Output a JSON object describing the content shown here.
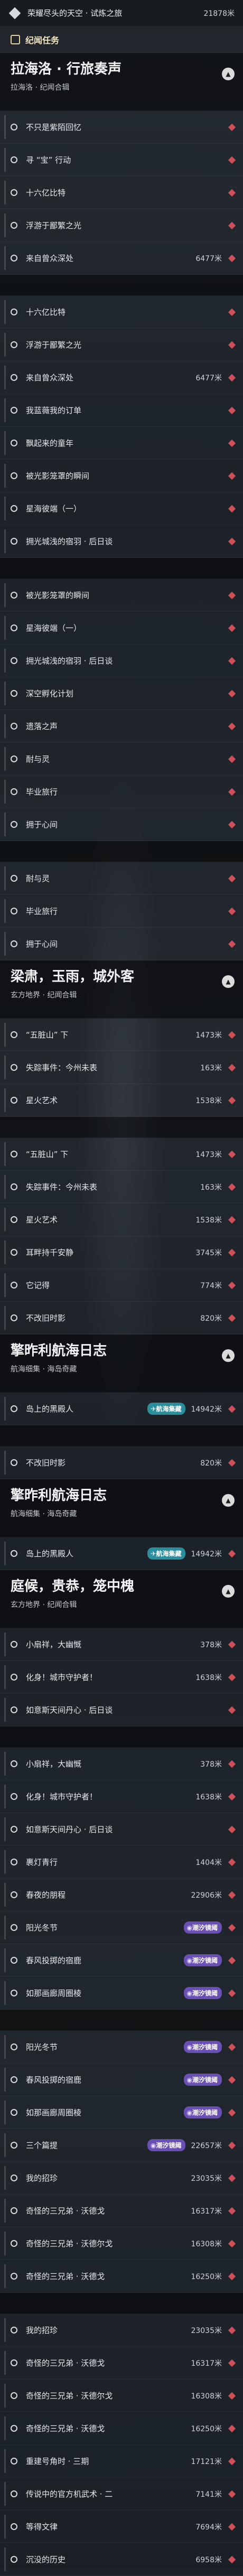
{
  "top": {
    "title": "荣耀尽头的天空 · 试炼之旅",
    "distance": "21878米"
  },
  "tab": {
    "label": "纪闻任务"
  },
  "items": [
    {
      "kind": "head",
      "title": "拉海洛 · 行旅奏声",
      "sub": "拉海洛 · 纪闻合辑"
    },
    {
      "kind": "item",
      "text": "不只是紫陌回忆",
      "dist": "",
      "marker": true
    },
    {
      "kind": "item",
      "text": "寻 “宝” 行动",
      "dist": "",
      "marker": true
    },
    {
      "kind": "item",
      "text": "十六亿比特",
      "dist": "",
      "marker": true
    },
    {
      "kind": "item",
      "text": "浮游于鄙繁之光",
      "dist": "",
      "marker": true
    },
    {
      "kind": "item",
      "text": "来自曾众深处",
      "dist": "6477米",
      "marker": true
    },
    {
      "kind": "gap"
    },
    {
      "kind": "item",
      "text": "十六亿比特",
      "dist": "",
      "marker": true
    },
    {
      "kind": "item",
      "text": "浮游于鄙繁之光",
      "dist": "",
      "marker": true
    },
    {
      "kind": "item",
      "text": "来自曾众深处",
      "dist": "6477米",
      "marker": true
    },
    {
      "kind": "item",
      "text": "我蓝薇我的订单",
      "dist": "",
      "marker": true
    },
    {
      "kind": "item",
      "text": "飘起来的童年",
      "dist": "",
      "marker": true
    },
    {
      "kind": "item",
      "text": "被光影笼罩的瞬间",
      "dist": "",
      "marker": true
    },
    {
      "kind": "item",
      "text": "星海彼端（一）",
      "dist": "",
      "marker": true
    },
    {
      "kind": "item",
      "text": "拥光城浅的宿羽 · 后日谈",
      "dist": "",
      "marker": true
    },
    {
      "kind": "gap"
    },
    {
      "kind": "item",
      "text": "被光影笼罩的瞬间",
      "dist": "",
      "marker": true
    },
    {
      "kind": "item",
      "text": "星海彼端（一）",
      "dist": "",
      "marker": true
    },
    {
      "kind": "item",
      "text": "拥光城浅的宿羽 · 后日谈",
      "dist": "",
      "marker": true
    },
    {
      "kind": "item",
      "text": "深空孵化计划",
      "dist": "",
      "marker": true
    },
    {
      "kind": "item",
      "text": "遗落之声",
      "dist": "",
      "marker": true
    },
    {
      "kind": "item",
      "text": "耐与灵",
      "dist": "",
      "marker": true
    },
    {
      "kind": "item",
      "text": "毕业旅行",
      "dist": "",
      "marker": true
    },
    {
      "kind": "item",
      "text": "拥于心间",
      "dist": "",
      "marker": true
    },
    {
      "kind": "gap"
    },
    {
      "kind": "item",
      "text": "耐与灵",
      "dist": "",
      "marker": true
    },
    {
      "kind": "item",
      "text": "毕业旅行",
      "dist": "",
      "marker": true
    },
    {
      "kind": "item",
      "text": "拥于心间",
      "dist": "",
      "marker": true
    },
    {
      "kind": "head",
      "title": "梁肃，玉雨，城外客",
      "sub": "玄方地界 · 纪闻合辑"
    },
    {
      "kind": "item",
      "text": "“五脏山” 下",
      "dist": "1473米",
      "marker": true
    },
    {
      "kind": "item",
      "text": "失踪事件：今州未表",
      "dist": "163米",
      "marker": true
    },
    {
      "kind": "item",
      "text": "星火艺术",
      "dist": "1538米",
      "marker": true
    },
    {
      "kind": "gap"
    },
    {
      "kind": "item",
      "text": "“五脏山” 下",
      "dist": "1473米",
      "marker": true
    },
    {
      "kind": "item",
      "text": "失踪事件：今州未表",
      "dist": "163米",
      "marker": true
    },
    {
      "kind": "item",
      "text": "星火艺术",
      "dist": "1538米",
      "marker": true
    },
    {
      "kind": "item",
      "text": "耳畔持千安静",
      "dist": "3745米",
      "marker": true
    },
    {
      "kind": "item",
      "text": "它记得",
      "dist": "774米",
      "marker": true
    },
    {
      "kind": "item",
      "text": "不改旧时影",
      "dist": "820米",
      "marker": true
    },
    {
      "kind": "head",
      "title": "擎昨利航海日志",
      "sub": "航海细集 · 海岛奇藏"
    },
    {
      "kind": "item",
      "text": "岛上的黑殿人",
      "dist": "14942米",
      "marker": true,
      "badge": "航海集藏",
      "badgeStyle": "teal"
    },
    {
      "kind": "gap"
    },
    {
      "kind": "item",
      "text": "不改旧时影",
      "dist": "820米",
      "marker": true
    },
    {
      "kind": "head",
      "title": "擎昨利航海日志",
      "sub": "航海细集 · 海岛奇藏"
    },
    {
      "kind": "item",
      "text": "岛上的黑殿人",
      "dist": "14942米",
      "marker": true,
      "badge": "航海集藏",
      "badgeStyle": "teal"
    },
    {
      "kind": "head",
      "title": "庭候，贵恭，笼中槐",
      "sub": "玄方地界 · 纪闻合辑"
    },
    {
      "kind": "item",
      "text": "小扇祥，大幽慨",
      "dist": "378米",
      "marker": true
    },
    {
      "kind": "item",
      "text": "化身！城市守护者！",
      "dist": "1638米",
      "marker": true
    },
    {
      "kind": "item",
      "text": "如意斯天间丹心 · 后日谈",
      "dist": "",
      "marker": true
    },
    {
      "kind": "gap"
    },
    {
      "kind": "item",
      "text": "小扇祥，大幽慨",
      "dist": "378米",
      "marker": true
    },
    {
      "kind": "item",
      "text": "化身！城市守护者！",
      "dist": "1638米",
      "marker": true
    },
    {
      "kind": "item",
      "text": "如意斯天间丹心 · 后日谈",
      "dist": "",
      "marker": true
    },
    {
      "kind": "item",
      "text": "裹灯青行",
      "dist": "1404米",
      "marker": true
    },
    {
      "kind": "item",
      "text": "春夜的朋程",
      "dist": "22906米",
      "marker": true
    },
    {
      "kind": "item",
      "text": "阳光冬节",
      "dist": "",
      "marker": true,
      "badge": "潮汐镜阈",
      "badgeStyle": "purple"
    },
    {
      "kind": "item",
      "text": "春风投掷的宿鹿",
      "dist": "",
      "marker": true,
      "badge": "潮汐镜阈",
      "badgeStyle": "purple"
    },
    {
      "kind": "item",
      "text": "如那画廊周圈棱",
      "dist": "",
      "marker": true,
      "badge": "潮汐镜阈",
      "badgeStyle": "purple"
    },
    {
      "kind": "gap"
    },
    {
      "kind": "item",
      "text": "阳光冬节",
      "dist": "",
      "marker": true,
      "badge": "潮汐镜阈",
      "badgeStyle": "purple"
    },
    {
      "kind": "item",
      "text": "春风投掷的宿鹿",
      "dist": "",
      "marker": true,
      "badge": "潮汐镜阈",
      "badgeStyle": "purple"
    },
    {
      "kind": "item",
      "text": "如那画廊周圈棱",
      "dist": "",
      "marker": true,
      "badge": "潮汐镜阈",
      "badgeStyle": "purple"
    },
    {
      "kind": "item",
      "text": "三个篇提",
      "dist": "22657米",
      "marker": true,
      "badge": "潮汐镜阈",
      "badgeStyle": "purple"
    },
    {
      "kind": "item",
      "text": "我的招珍",
      "dist": "23035米",
      "marker": true
    },
    {
      "kind": "item",
      "text": "奇怪的三兄弟 · 沃德戈",
      "dist": "16317米",
      "marker": true
    },
    {
      "kind": "item",
      "text": "奇怪的三兄弟 · 沃德尔戈",
      "dist": "16308米",
      "marker": true
    },
    {
      "kind": "item",
      "text": "奇怪的三兄弟 · 沃德戈",
      "dist": "16250米",
      "marker": true
    },
    {
      "kind": "gap"
    },
    {
      "kind": "item",
      "text": "我的招珍",
      "dist": "23035米",
      "marker": true
    },
    {
      "kind": "item",
      "text": "奇怪的三兄弟 · 沃德戈",
      "dist": "16317米",
      "marker": true
    },
    {
      "kind": "item",
      "text": "奇怪的三兄弟 · 沃德尔戈",
      "dist": "16308米",
      "marker": true
    },
    {
      "kind": "item",
      "text": "奇怪的三兄弟 · 沃德戈",
      "dist": "16250米",
      "marker": true
    },
    {
      "kind": "item",
      "text": "重建号角时 · 三期",
      "dist": "17121米",
      "marker": true
    },
    {
      "kind": "item",
      "text": "传说中的官方机武术 · 二",
      "dist": "7141米",
      "marker": true
    },
    {
      "kind": "item",
      "text": "等得文律",
      "dist": "7694米",
      "marker": true
    },
    {
      "kind": "item",
      "text": "沉没的历史",
      "dist": "6958米",
      "marker": true
    }
  ]
}
